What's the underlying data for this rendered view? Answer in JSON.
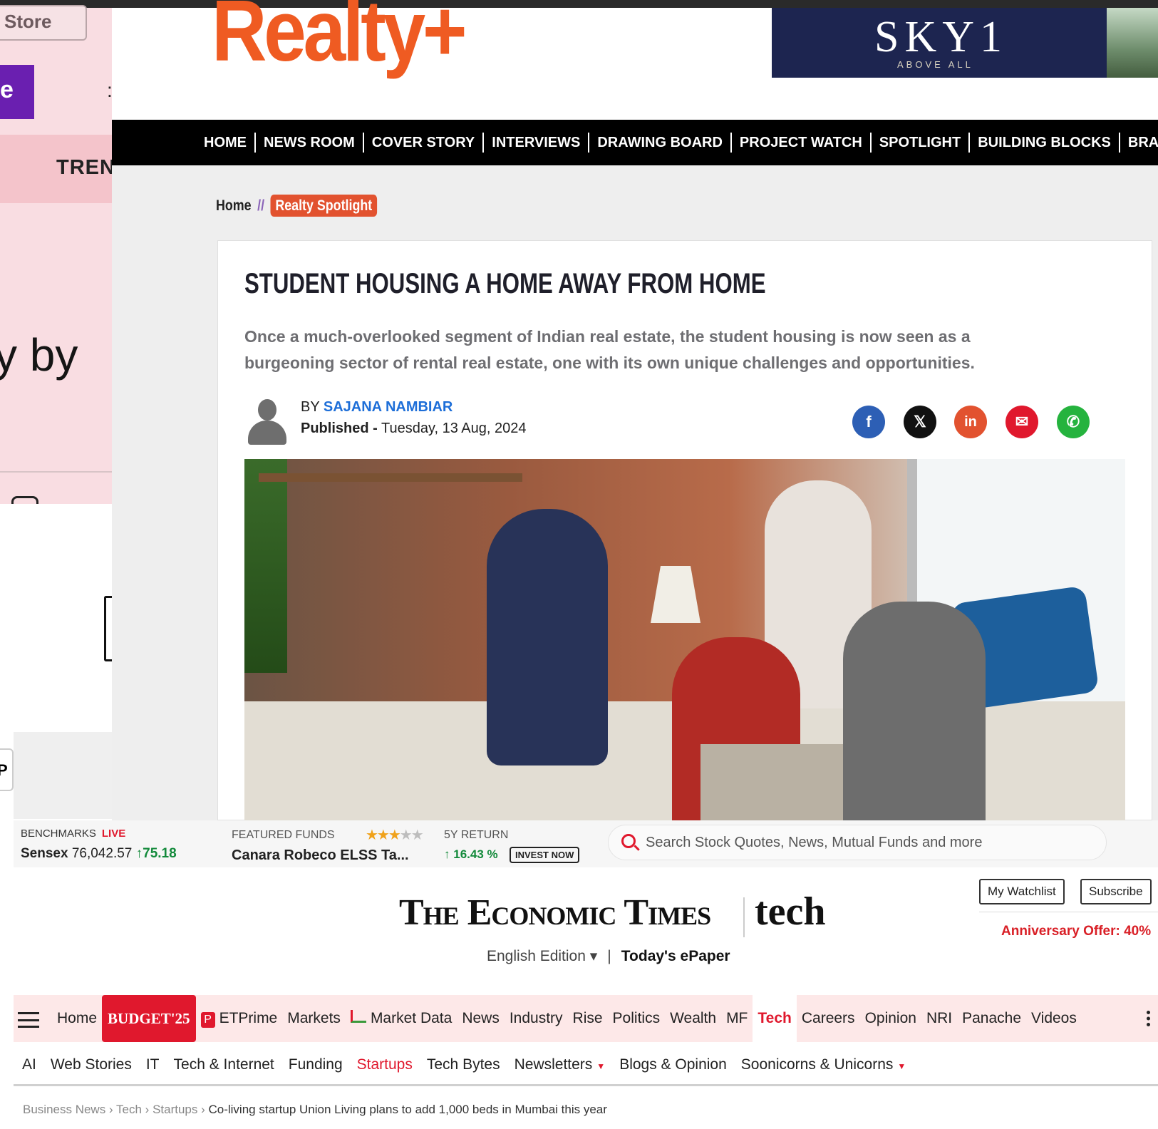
{
  "left_panel": {
    "store_label": "Store",
    "purple_label": "e",
    "colon": ":",
    "trending_label": "TRENI",
    "by_text": "y by",
    "edge_glyph": "P"
  },
  "realty": {
    "logo": "Realty+",
    "ad": {
      "brand": "SKY1",
      "tagline": "ABOVE ALL"
    },
    "nav": [
      "HOME",
      "NEWS ROOM",
      "COVER STORY",
      "INTERVIEWS",
      "DRAWING BOARD",
      "PROJECT WATCH",
      "SPOTLIGHT",
      "BUILDING BLOCKS",
      "BRA"
    ],
    "breadcrumb": {
      "home": "Home",
      "sep": "//",
      "section": "Realty Spotlight"
    },
    "article": {
      "title": "STUDENT HOUSING A HOME AWAY FROM HOME",
      "lede": "Once a much-overlooked segment of Indian real estate, the student housing is now seen as a burgeoning sector of rental real estate, one with its own unique challenges and opportunities.",
      "by_prefix": "BY",
      "author": "SAJANA NAMBIAR",
      "published_label": "Published -",
      "published_date": "Tuesday, 13 Aug, 2024",
      "share": [
        {
          "name": "facebook-icon",
          "glyph": "f",
          "color": "#2d5fb5"
        },
        {
          "name": "x-icon",
          "glyph": "𝕏",
          "color": "#111111"
        },
        {
          "name": "linkedin-icon",
          "glyph": "in",
          "color": "#e2522f"
        },
        {
          "name": "mail-icon",
          "glyph": "✉",
          "color": "#e0182d"
        },
        {
          "name": "whatsapp-icon",
          "glyph": "✆",
          "color": "#25b33e"
        }
      ]
    }
  },
  "et": {
    "ticker": {
      "benchmarks_label": "BENCHMARKS",
      "live_label": "LIVE",
      "sensex_label": "Sensex",
      "sensex_value": "76,042.57",
      "sensex_change": "75.18",
      "featured_label": "FEATURED FUNDS",
      "fund_name": "Canara Robeco ELSS Ta...",
      "fund_rating": 3,
      "return_label": "5Y RETURN",
      "return_value": "16.43 %",
      "invest_label": "INVEST NOW",
      "search_placeholder": "Search Stock Quotes, News, Mutual Funds and more"
    },
    "masthead": {
      "name": "The Economic Times",
      "section": "tech"
    },
    "edition": "English Edition ▾",
    "epaper": "Today's ePaper",
    "watchlist_label": "My Watchlist",
    "subscribe_label": "Subscribe",
    "offer": "Anniversary Offer: 40%",
    "main_nav": [
      "Home",
      "BUDGET'25",
      "ETPrime",
      "Markets",
      "Market Data",
      "News",
      "Industry",
      "Rise",
      "Politics",
      "Wealth",
      "MF",
      "Tech",
      "Careers",
      "Opinion",
      "NRI",
      "Panache",
      "Videos"
    ],
    "sub_nav": [
      "AI",
      "Web Stories",
      "IT",
      "Tech & Internet",
      "Funding",
      "Startups",
      "Tech Bytes",
      "Newsletters",
      "Blogs & Opinion",
      "Soonicorns & Unicorns"
    ],
    "breadcrumb": [
      "Business News",
      "Tech",
      "Startups",
      "Co-living startup Union Living plans to add 1,000 beds in Mumbai this year"
    ]
  }
}
